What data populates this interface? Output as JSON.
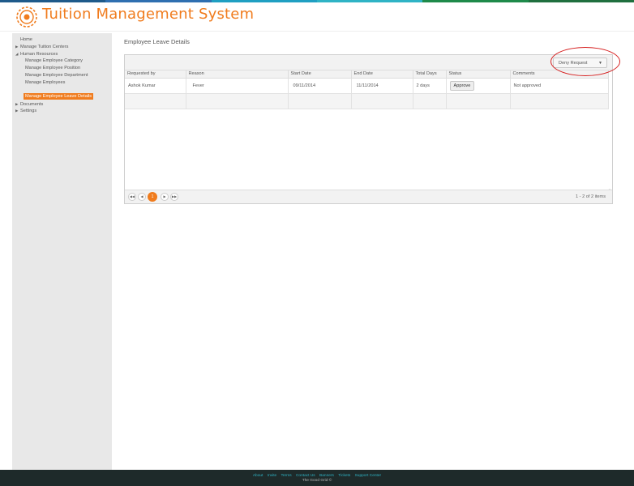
{
  "colors": {
    "accent": "#f07c1e",
    "stripe": [
      "#2f6fb0",
      "#1f9fc2",
      "#2fb3c5",
      "#1e8a4a",
      "#1f6f3e",
      "#1e5a8a"
    ],
    "annotation": "#d62020",
    "footer_bg": "#1e2a2a",
    "footer_link": "#2fb3c5"
  },
  "header": {
    "title": "Tuition Management System",
    "logo_icon": "gear-logo-icon"
  },
  "sidebar": {
    "items": [
      {
        "label": "Home",
        "level": "top",
        "caret": false
      },
      {
        "label": "Manage Tuition Centers",
        "level": "top",
        "caret": "right"
      },
      {
        "label": "Human Resources",
        "level": "top",
        "caret": "down"
      },
      {
        "label": "Manage Employee Category",
        "level": "sub"
      },
      {
        "label": "Manage Employee Position",
        "level": "sub"
      },
      {
        "label": "Manage Employee Department",
        "level": "sub"
      },
      {
        "label": "Manage Employees",
        "level": "sub"
      },
      {
        "label": "Manage Employee Leave Details",
        "level": "sub",
        "active": true
      },
      {
        "label": "Documents",
        "level": "top",
        "caret": "right"
      },
      {
        "label": "Settings",
        "level": "top",
        "caret": "right"
      }
    ]
  },
  "main": {
    "heading": "Employee Leave Details",
    "toolbar": {
      "dropdown_value": "Deny Request",
      "dropdown_icon": "chevron-down-icon"
    },
    "table": {
      "columns": [
        "Requested by",
        "Reason",
        "Start Date",
        "End Date",
        "Total Days",
        "Status",
        "Comments"
      ],
      "rows": [
        {
          "requested_by": "Ashok Kumar",
          "reason": "Fever",
          "start_date": "09/11/2014",
          "end_date": "11/11/2014",
          "total_days": "2 days",
          "status": "Approve",
          "comments": "Not approved"
        }
      ]
    },
    "pager": {
      "first_icon": "first-page-icon",
      "prev_icon": "prev-page-icon",
      "current_page": "1",
      "next_icon": "next-page-icon",
      "last_icon": "last-page-icon",
      "info": "1 - 2 of 2 items"
    }
  },
  "footer": {
    "links": [
      "About",
      "Invite",
      "Terms",
      "Contact Us",
      "Banners",
      "Tickets",
      "Support Center"
    ],
    "copyright": "The Good Grid ©"
  }
}
